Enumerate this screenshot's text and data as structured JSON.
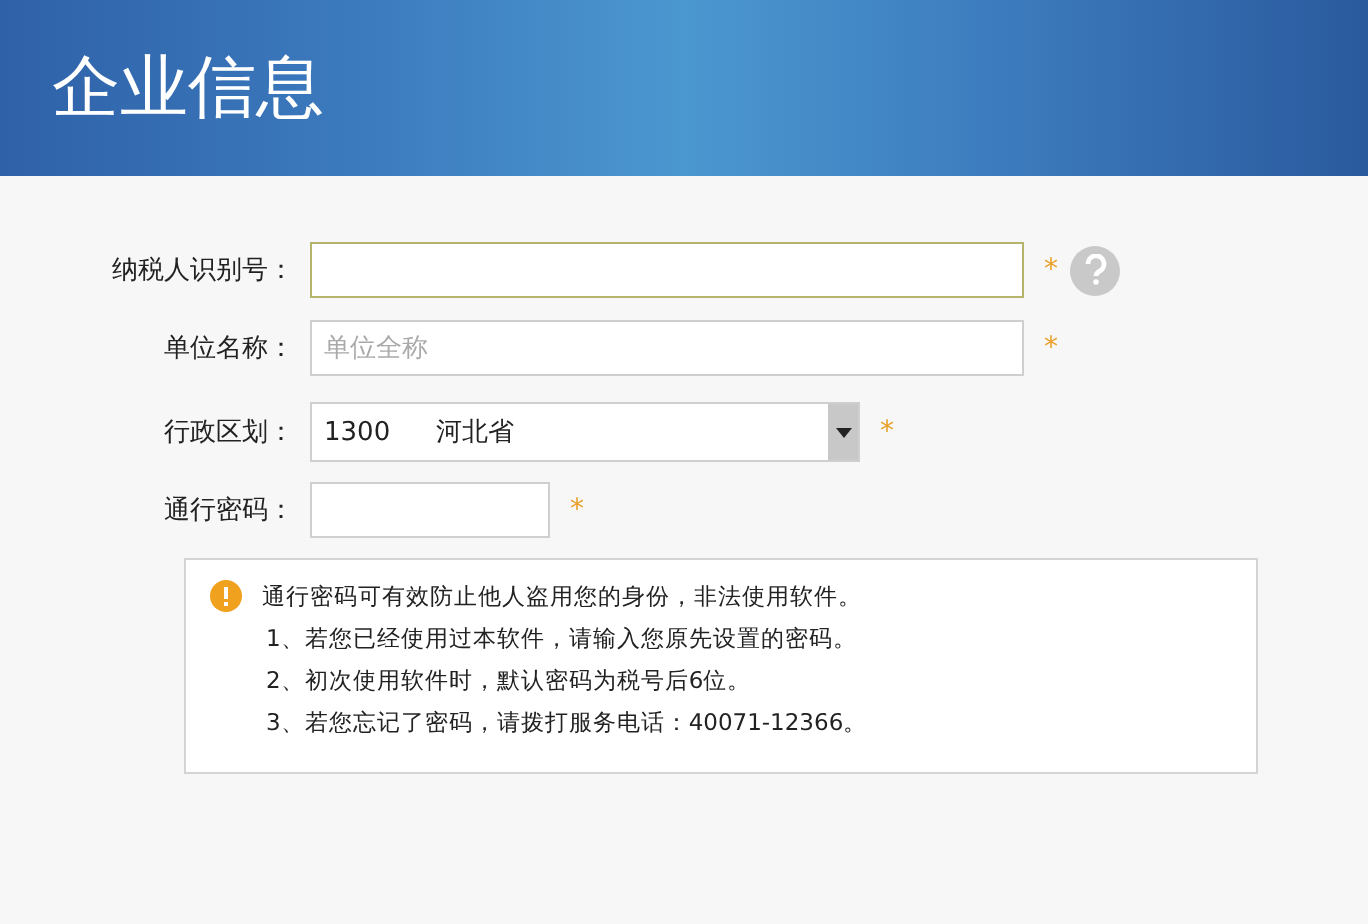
{
  "header": {
    "title": "企业信息"
  },
  "fields": [
    {
      "kind": "text",
      "label": "纳税人识别号：",
      "focused": true,
      "required_mark": "*",
      "help": true
    },
    {
      "kind": "text",
      "label": "单位名称：",
      "placeholder": "单位全称",
      "focused": false,
      "required_mark": "*",
      "help": false
    },
    {
      "kind": "select",
      "label": "行政区划：",
      "code": "1300",
      "value": "河北省",
      "focused": false,
      "required_mark": "*",
      "help": false
    },
    {
      "kind": "password",
      "label": "通行密码：",
      "focused": false,
      "required_mark": "*",
      "help": false
    }
  ],
  "note": {
    "title": "通行密码可有效防止他人盗用您的身份，非法使用软件。",
    "items": [
      "1、若您已经使用过本软件，请输入您原先设置的密码。",
      "2、初次使用软件时，默认密码为税号后6位。",
      "3、若您忘记了密码，请拨打服务电话：40071-12366。"
    ]
  }
}
